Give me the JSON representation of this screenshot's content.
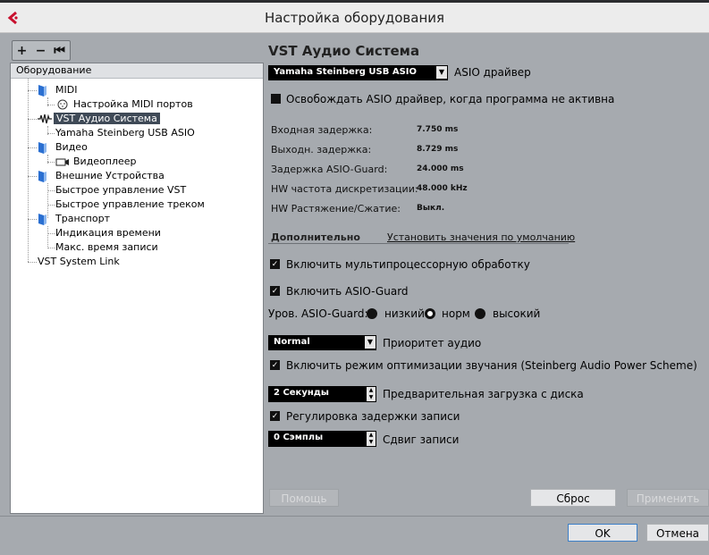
{
  "window": {
    "title": "Настройка оборудования"
  },
  "toolbar": {
    "add": "+",
    "remove": "−",
    "reset": "⏮"
  },
  "tree": {
    "header": "Оборудование",
    "items": [
      {
        "label": "MIDI"
      },
      {
        "label": "Настройка MIDI портов"
      },
      {
        "label": "VST Аудио Система"
      },
      {
        "label": "Yamaha Steinberg USB ASIO"
      },
      {
        "label": "Видео"
      },
      {
        "label": "Видеоплеер"
      },
      {
        "label": "Внешние Устройства"
      },
      {
        "label": "Быстрое управление VST"
      },
      {
        "label": "Быстрое управление треком"
      },
      {
        "label": "Транспорт"
      },
      {
        "label": "Индикация времени"
      },
      {
        "label": "Макс. время записи"
      },
      {
        "label": "VST System Link"
      }
    ]
  },
  "panel": {
    "title": "VST Аудио Система",
    "asio_driver_value": "Yamaha Steinberg USB ASIO",
    "asio_driver_label": "ASIO драйвер",
    "release_driver_label": "Освобождать ASIO драйвер, когда программа не активна",
    "info": [
      {
        "label": "Входная задержка:",
        "value": "7.750 ms"
      },
      {
        "label": "Выходн. задержка:",
        "value": "8.729 ms"
      },
      {
        "label": "Задержка ASIO-Guard:",
        "value": "24.000 ms"
      },
      {
        "label": "HW частота дискретизации:",
        "value": "48.000 kHz"
      },
      {
        "label": "HW Растяжение/Сжатие:",
        "value": "Выкл."
      }
    ],
    "tab_advanced": "Дополнительно",
    "tab_defaults": "Установить значения по умолчанию",
    "multiprocessing_label": "Включить мультипроцессорную обработку",
    "asio_guard_label": "Включить ASIO-Guard",
    "asio_guard_level_label": "Уров. ASIO-Guard:",
    "level_low": "низкий",
    "level_normal": "норм",
    "level_high": "высокий",
    "audio_priority_value": "Normal",
    "audio_priority_label": "Приоритет аудио",
    "power_scheme_label": "Включить режим оптимизации звучания (Steinberg Audio Power Scheme)",
    "preload_value": "2 Секунды",
    "preload_label": "Предварительная загрузка с диска",
    "record_latency_label": "Регулировка задержки записи",
    "record_shift_value": "0 Сэмплы",
    "record_shift_label": "Сдвиг записи"
  },
  "buttons": {
    "help": "Помощь",
    "reset": "Сброс",
    "apply": "Применить",
    "ok": "OK",
    "cancel": "Отмена"
  }
}
